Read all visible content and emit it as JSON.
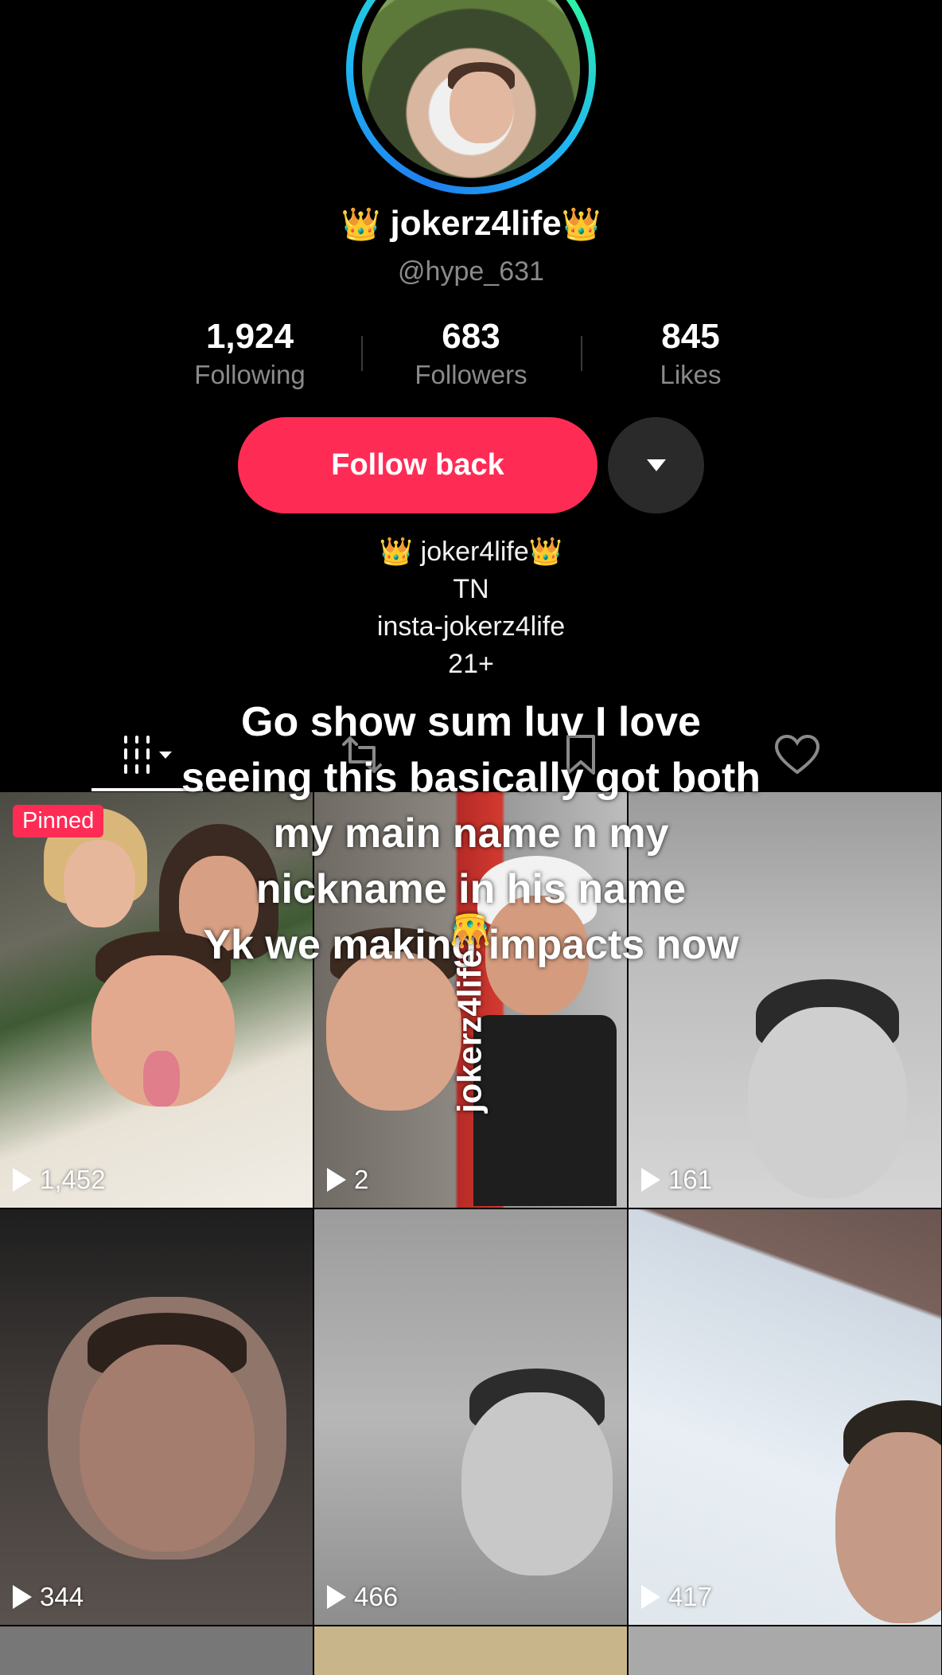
{
  "profile": {
    "display_name": "jokerz4life",
    "crown_emoji": "👑",
    "username": "@hype_631",
    "stats": [
      {
        "value": "1,924",
        "label": "Following"
      },
      {
        "value": "683",
        "label": "Followers"
      },
      {
        "value": "845",
        "label": "Likes"
      }
    ],
    "follow_button_label": "Follow back",
    "bio_lines": [
      "👑 joker4life👑",
      "TN",
      "insta-jokerz4life",
      "21+"
    ]
  },
  "tabs": [
    {
      "name": "videos",
      "icon": "grid-icon"
    },
    {
      "name": "reposts",
      "icon": "repost-icon"
    },
    {
      "name": "favorites",
      "icon": "bookmark-icon"
    },
    {
      "name": "liked",
      "icon": "heart-icon"
    }
  ],
  "videos": [
    {
      "views": "1,452",
      "pinned": true,
      "pinned_label": "Pinned"
    },
    {
      "views": "2",
      "pinned": false
    },
    {
      "views": "161",
      "pinned": false
    },
    {
      "views": "344",
      "pinned": false
    },
    {
      "views": "466",
      "pinned": false
    },
    {
      "views": "417",
      "pinned": false
    }
  ],
  "overlay": {
    "caption_lines": [
      "Go show sum luv I love",
      "seeing this basically got both",
      "my main name n my",
      "nickname in his name",
      "Yk we making impacts now"
    ],
    "vertical_tag": "jokerz4life👑"
  },
  "colors": {
    "accent": "#fe2c55",
    "background": "#000000",
    "muted": "#8a8a8a"
  }
}
